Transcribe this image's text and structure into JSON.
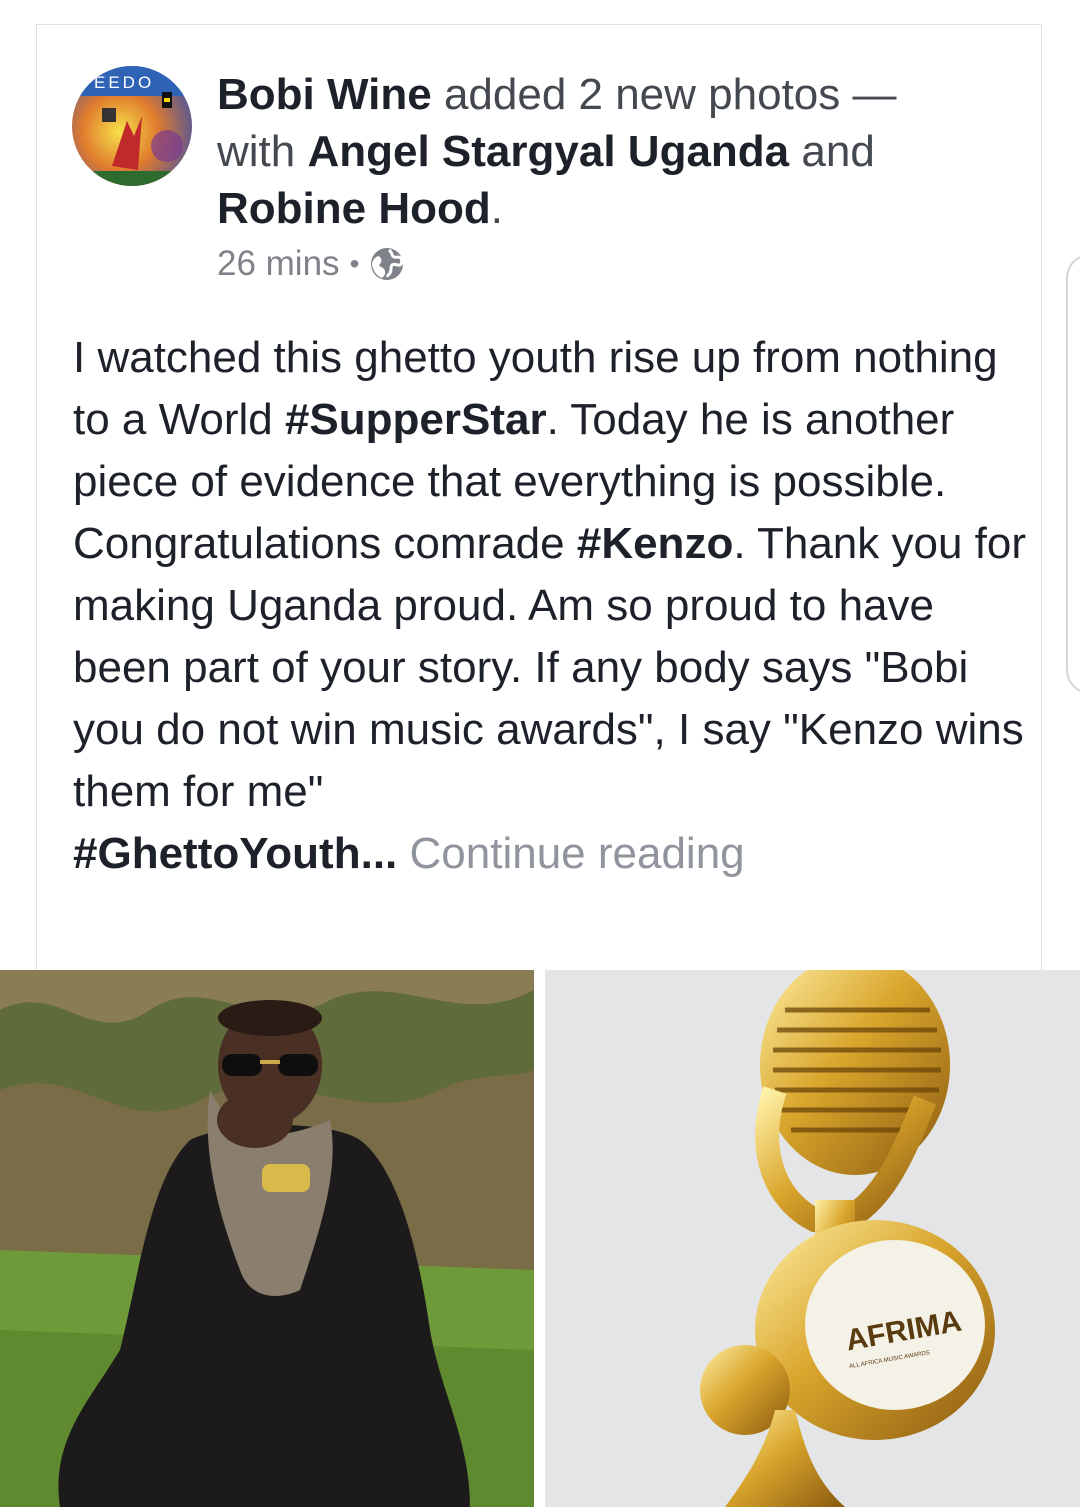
{
  "post": {
    "author": "Bobi Wine",
    "action": "added 2 new photos —",
    "with_label": "with",
    "tagged_1": "Angel Stargyal Uganda",
    "and_label": "and",
    "tagged_2": "Robine Hood",
    "period": ".",
    "time": "26 mins",
    "separator": "•",
    "privacy_icon": "globe-icon",
    "text": {
      "p1": "I watched this ghetto youth rise up from nothing to a World ",
      "tag_superstar": "#SupperStar",
      "p2": ". Today he is another piece of evidence that everything is possible. Congratulations comrade ",
      "tag_kenzo": "#Kenzo",
      "p3": ". Thank you for making Uganda proud. Am so proud to have been part of your story. If any body says \"Bobi you do not win music awards\",  I say \"Kenzo wins them for me\"",
      "tag_ghetto": "#GhettoYouth",
      "ellipsis": "...",
      "continue": " Continue reading"
    },
    "avatar_text": "EEDO",
    "photos": {
      "right_logo": "AFRIMA",
      "right_logo_sub": "ALL AFRICA MUSIC AWARDS"
    }
  }
}
